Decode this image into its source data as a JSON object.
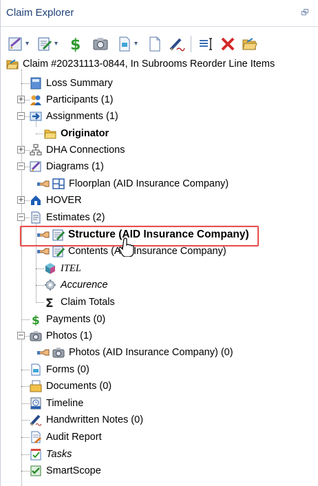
{
  "window": {
    "title": "Claim Explorer",
    "pin_glyph": "⮺"
  },
  "toolbar": {
    "buttons": [
      {
        "name": "edit-claim-icon",
        "has_dropdown": true
      },
      {
        "name": "edit-document-icon",
        "has_dropdown": true
      },
      {
        "name": "dollar-icon",
        "has_dropdown": false
      },
      {
        "name": "camera-icon",
        "has_dropdown": false
      },
      {
        "name": "new-page-icon",
        "has_dropdown": true
      },
      {
        "name": "blank-page-icon",
        "has_dropdown": false
      },
      {
        "name": "handwritten-note-icon",
        "has_dropdown": false
      },
      {
        "name": "text-cursor-icon",
        "has_dropdown": false
      },
      {
        "name": "delete-x-icon",
        "has_dropdown": false
      },
      {
        "name": "open-folder-icon",
        "has_dropdown": false
      }
    ],
    "dropdown_glyph": "▾"
  },
  "tree": {
    "root": {
      "label": "Claim #20231113-0844, In Subrooms Reorder Line Items",
      "icon": "claim-folder-icon"
    },
    "items": [
      {
        "label": "Loss Summary",
        "icon": "document-blue-icon"
      },
      {
        "label": "Participants (1)",
        "icon": "people-icon",
        "expander": "+"
      },
      {
        "label": "Assignments (1)",
        "icon": "assignment-arrow-icon",
        "expander": "−"
      },
      {
        "label": "Originator",
        "icon": "folder-icon"
      },
      {
        "label": "DHA Connections",
        "icon": "network-icon",
        "expander": "+"
      },
      {
        "label": "Diagrams (1)",
        "icon": "diagram-icon",
        "expander": "−"
      },
      {
        "label": "Floorplan (AID Insurance Company)",
        "icon": "floorplan-icon"
      },
      {
        "label": "HOVER",
        "icon": "hover-house-icon",
        "expander": "+"
      },
      {
        "label": "Estimates (2)",
        "icon": "estimate-doc-icon",
        "expander": "−"
      },
      {
        "label": "Structure (AID Insurance Company)",
        "icon": "estimate-edit-icon"
      },
      {
        "label": "Contents (AID Insurance Company)",
        "icon": "estimate-edit-icon"
      },
      {
        "label": "ITEL",
        "icon": "itel-cube-icon"
      },
      {
        "label": "Accurence",
        "icon": "accurence-gear-icon"
      },
      {
        "label": "Claim Totals",
        "icon": "sigma-icon"
      },
      {
        "label": "Payments (0)",
        "icon": "dollar-green-icon"
      },
      {
        "label": "Photos (1)",
        "icon": "camera-icon",
        "expander": "−"
      },
      {
        "label": "Photos (AID Insurance Company) (0)",
        "icon": "camera-icon"
      },
      {
        "label": "Forms (0)",
        "icon": "form-page-icon"
      },
      {
        "label": "Documents (0)",
        "icon": "documents-stack-icon"
      },
      {
        "label": "Timeline",
        "icon": "timeline-icon"
      },
      {
        "label": "Handwritten Notes (0)",
        "icon": "handwritten-note-icon"
      },
      {
        "label": "Audit Report",
        "icon": "audit-report-icon"
      },
      {
        "label": "Tasks",
        "icon": "tasks-icon"
      },
      {
        "label": "SmartScope",
        "icon": "smartscope-icon"
      }
    ],
    "selected": "Structure (AID Insurance Company)",
    "highlight_color": "#e85050",
    "selected_text_color": "#1a66c7"
  }
}
